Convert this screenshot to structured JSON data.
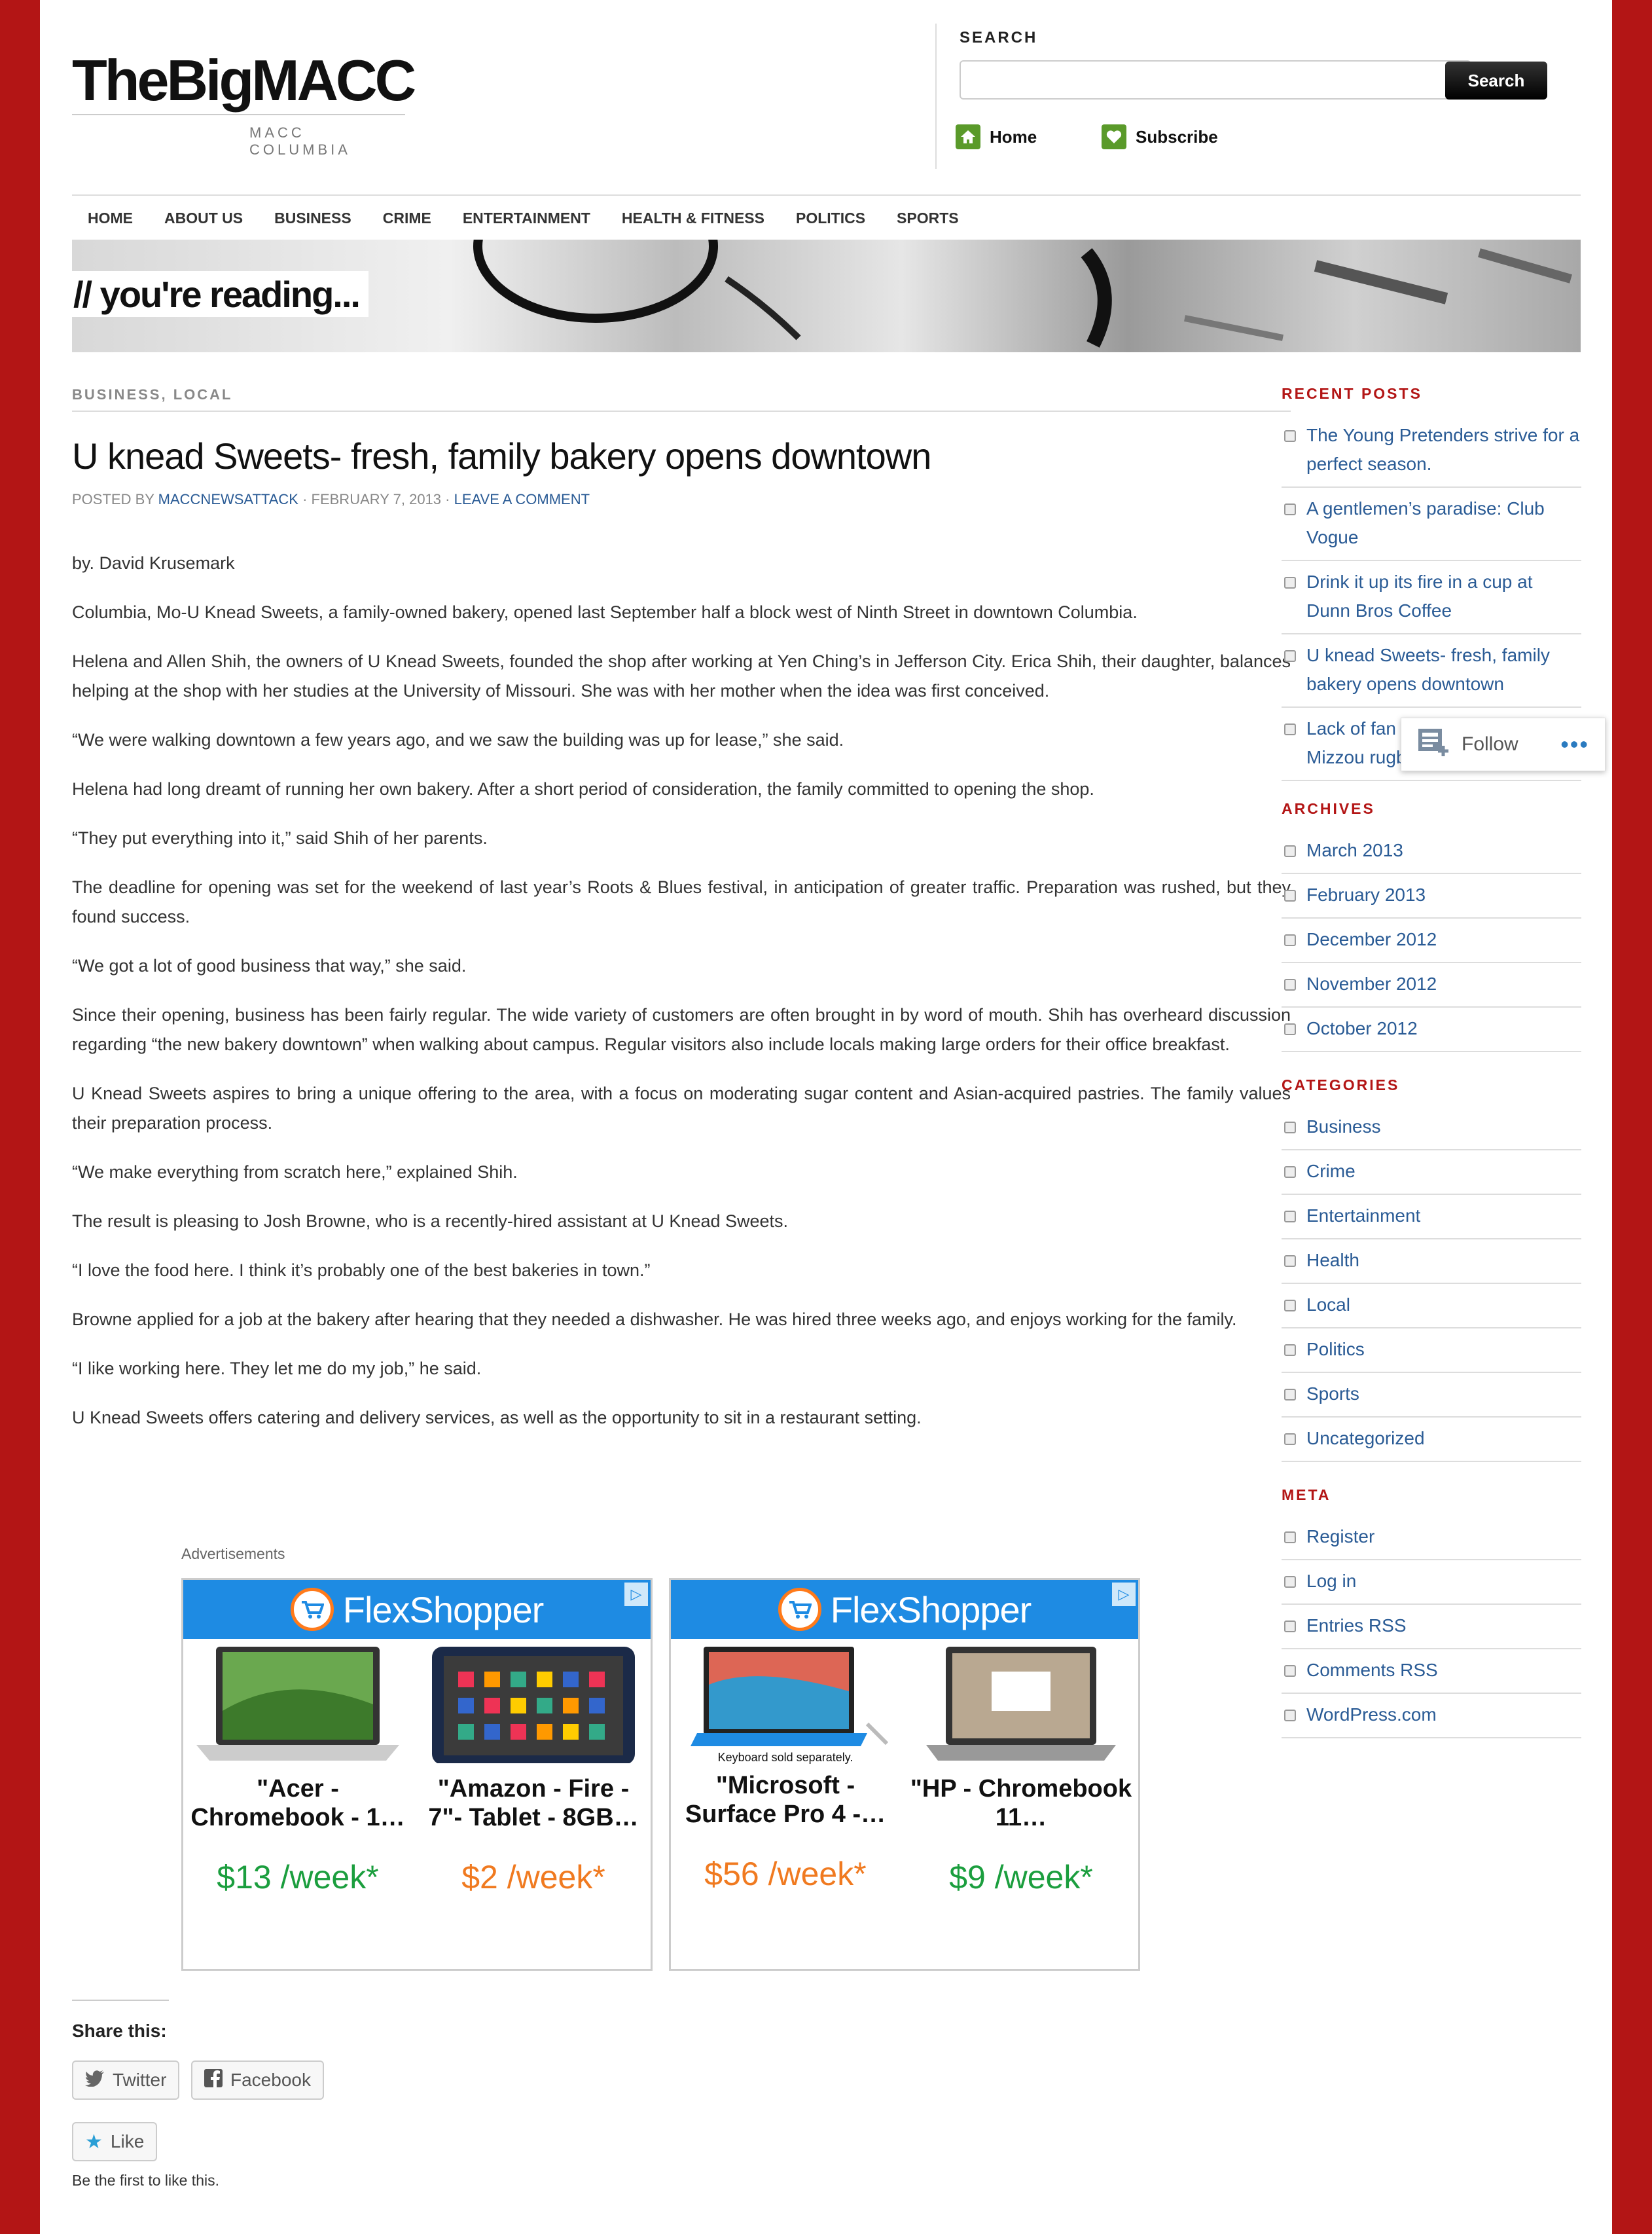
{
  "header": {
    "site_title": "TheBigMACC",
    "tagline": "MACC COLUMBIA",
    "search_label": "SEARCH",
    "search_placeholder": "",
    "search_button": "Search",
    "links": [
      "Home",
      "Subscribe"
    ]
  },
  "nav": [
    "HOME",
    "ABOUT US",
    "BUSINESS",
    "CRIME",
    "ENTERTAINMENT",
    "HEALTH & FITNESS",
    "POLITICS",
    "SPORTS"
  ],
  "banner": {
    "label": "//  you're reading..."
  },
  "post": {
    "categories": "BUSINESS, LOCAL",
    "title": "U knead Sweets- fresh, family bakery opens downtown",
    "meta": {
      "posted_by": "POSTED BY",
      "author": "MACCNEWSATTACK",
      "sep1": " · ",
      "date": "FEBRUARY 7, 2013",
      "sep2": " · ",
      "comment_link": "LEAVE A COMMENT"
    },
    "paragraphs": [
      "by. David Krusemark",
      "Columbia, Mo-U Knead Sweets, a family-owned bakery, opened last September half a block west of Ninth Street in downtown Columbia.",
      "Helena and Allen Shih, the owners of U Knead Sweets, founded the shop after working at Yen Ching’s in Jefferson City. Erica Shih, their daughter, balances helping at the shop with her studies at the University of Missouri. She was with her mother when the idea was first conceived.",
      "“We were walking downtown a few years ago, and we saw the building was up for lease,” she said.",
      "Helena had long dreamt of running her own bakery. After a short period of consideration, the family committed to opening the shop.",
      "“They put everything into it,” said Shih of her parents.",
      "The deadline for opening was set for the weekend of last year’s Roots & Blues festival, in anticipation of greater traffic. Preparation was rushed, but they found success.",
      "“We got a lot of good business that way,” she said.",
      "Since their opening, business has been fairly regular. The wide variety of customers are often brought in by word of mouth. Shih has overheard discussion regarding “the new bakery downtown” when walking about campus. Regular visitors also include locals making large orders for their office breakfast.",
      "U Knead Sweets aspires to bring a unique offering to the area, with a focus on moderating sugar content and Asian-acquired pastries. The family values their preparation process.",
      "“We make everything from scratch here,” explained Shih.",
      "The result is pleasing to Josh Browne, who is a recently-hired assistant at U Knead Sweets.",
      "“I love the food here. I think it’s probably one of the best bakeries in town.”",
      "Browne applied for a job at the bakery after hearing that they needed a dishwasher. He was hired three weeks ago, and enjoys working for the family.",
      "“I like working here. They let me do my job,” he said.",
      "U Knead Sweets offers catering and delivery services, as well as the opportunity to sit in a restaurant setting."
    ]
  },
  "ads": {
    "label": "Advertisements",
    "brand": "FlexShopper",
    "products": [
      {
        "name": "\"Acer - Chromebook - 1…",
        "price": "$13 /week*",
        "price_color": "#1b9e3e"
      },
      {
        "name": "\"Amazon - Fire - 7\"- Tablet - 8GB…",
        "price": "$2 /week*",
        "price_color": "#f07a20"
      },
      {
        "name": "\"Microsoft - Surface Pro 4 -…",
        "price": "$56 /week*",
        "price_color": "#f07a20",
        "caption": "Keyboard sold separately."
      },
      {
        "name": "\"HP - Chromebook 11…",
        "price": "$9 /week*",
        "price_color": "#1b9e3e"
      }
    ]
  },
  "share": {
    "label": "Share this:",
    "twitter": "Twitter",
    "facebook": "Facebook",
    "like": "Like",
    "like_note": "Be the first to like this."
  },
  "sidebar": {
    "recent_posts": {
      "heading": "RECENT POSTS",
      "items": [
        "The Young Pretenders strive for a perfect season.",
        "A gentlemen’s paradise: Club Vogue",
        "Drink it up its fire in a cup at Dunn Bros Coffee",
        "U knead Sweets- fresh, family bakery opens downtown",
        "Lack of fan base on track for Mizzou rugby"
      ]
    },
    "archives": {
      "heading": "ARCHIVES",
      "items": [
        "March 2013",
        "February 2013",
        "December 2012",
        "November 2012",
        "October 2012"
      ]
    },
    "categories": {
      "heading": "CATEGORIES",
      "items": [
        "Business",
        "Crime",
        "Entertainment",
        "Health",
        "Local",
        "Politics",
        "Sports",
        "Uncategorized"
      ]
    },
    "meta": {
      "heading": "META",
      "items": [
        "Register",
        "Log in",
        "Entries RSS",
        "Comments RSS",
        "WordPress.com"
      ]
    }
  },
  "follow_widget": {
    "label": "Follow"
  },
  "colors": {
    "frame": "#b31515",
    "link": "#2a5b95",
    "accent_green": "#5a9a2a",
    "ad_blue": "#1e8be3"
  }
}
